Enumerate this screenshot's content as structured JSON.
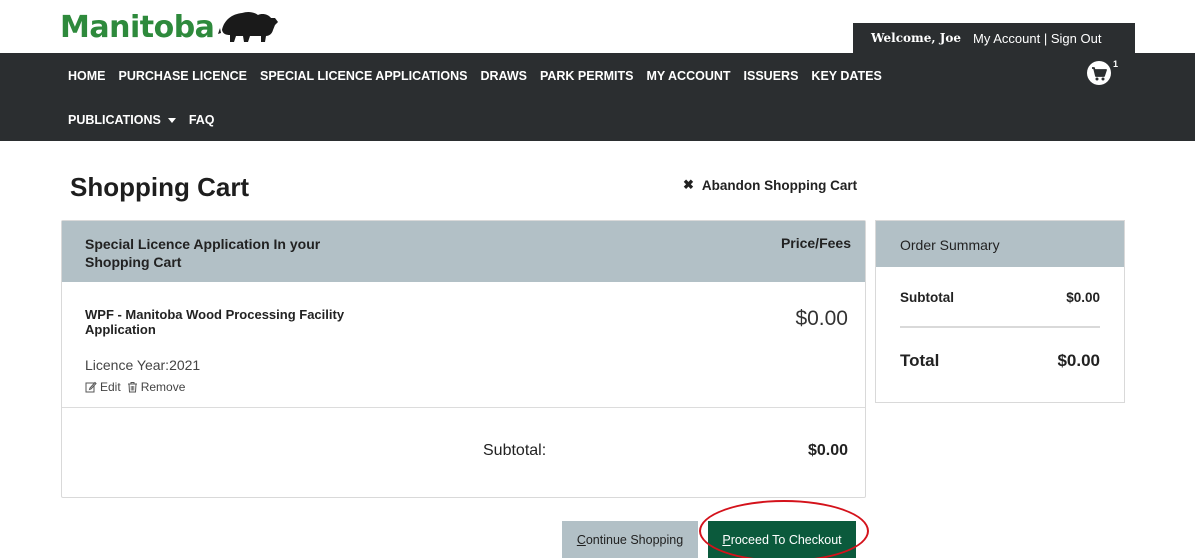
{
  "brand": {
    "logo_text": "Manitoba",
    "accent_color": "#2e8a3c"
  },
  "account": {
    "welcome": "Welcome, Joe",
    "my_account": "My Account",
    "separator": "|",
    "sign_out": "Sign Out"
  },
  "nav": {
    "row1": [
      "HOME",
      "PURCHASE LICENCE",
      "SPECIAL LICENCE APPLICATIONS",
      "DRAWS",
      "PARK PERMITS",
      "MY ACCOUNT",
      "ISSUERS",
      "KEY DATES"
    ],
    "publications": "PUBLICATIONS",
    "faq": "FAQ",
    "cart_count": "1",
    "bar_color": "#2b2e30"
  },
  "page": {
    "title": "Shopping Cart",
    "abandon_label": "Abandon Shopping Cart"
  },
  "cart": {
    "header_title": "Special Licence Application In your Shopping Cart",
    "header_price": "Price/Fees",
    "item": {
      "name": "WPF - Manitoba Wood Processing Facility Application",
      "price": "$0.00",
      "licence_year": "Licence Year:2021",
      "edit_label": "Edit",
      "remove_label": "Remove"
    },
    "subtotal_label": "Subtotal:",
    "subtotal_value": "$0.00",
    "header_color": "#b2c0c6"
  },
  "summary": {
    "title": "Order Summary",
    "subtotal_label": "Subtotal",
    "subtotal_value": "$0.00",
    "total_label": "Total",
    "total_value": "$0.00"
  },
  "buttons": {
    "continue_first": "C",
    "continue_rest": "ontinue Shopping",
    "checkout_first": "P",
    "checkout_rest": "roceed To Checkout",
    "checkout_color": "#0b5a3c",
    "highlight_color": "#d4121b"
  }
}
